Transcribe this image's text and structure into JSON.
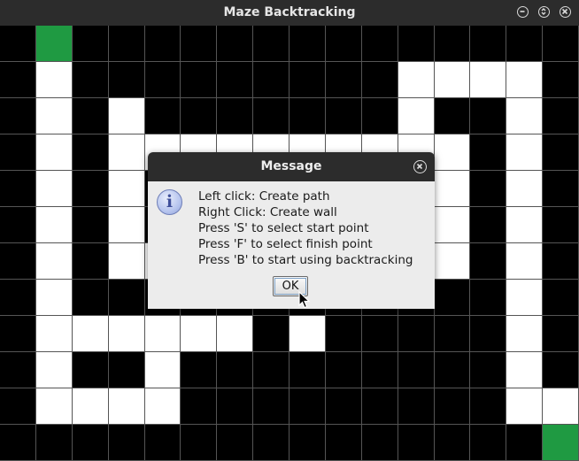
{
  "window": {
    "title": "Maze Backtracking",
    "buttons": [
      "minimize-icon",
      "maximize-icon",
      "close-icon"
    ]
  },
  "maze": {
    "cols": 16,
    "rows": 12,
    "legend": {
      "b": "wall",
      "w": "path",
      "g": "start-or-finish"
    },
    "cells": [
      "bgbbbbbbbbbbbbbb",
      "bwbbbbbbbbbwwwwb",
      "bwbwbbbbbbbwbbwb",
      "bwbwwwwwwwwwwbwb",
      "bwbwbbbbbbbbwbwb",
      "bwbwbbbbbbbbwbwb",
      "bwbwwbbbbbbbwbwb",
      "bwbbbbbbbbbbbbwb",
      "bwwwwwwbwbbbbbwb",
      "bwbbwbbbbbbbbbwb",
      "bwwwwbbbbbbbbbww",
      "bbbbbbbbbbbbbbbg"
    ],
    "colors": {
      "wall": "#000000",
      "path": "#ffffff",
      "endpoint": "#1f9a42",
      "gridline": "#555555"
    }
  },
  "dialog": {
    "title": "Message",
    "icon": "info-icon",
    "lines": [
      "Left click: Create path",
      "Right Click: Create wall",
      "Press 'S' to select start point",
      "Press 'F' to select finish point",
      "Press 'B' to start using backtracking"
    ],
    "ok_label": "OK"
  }
}
